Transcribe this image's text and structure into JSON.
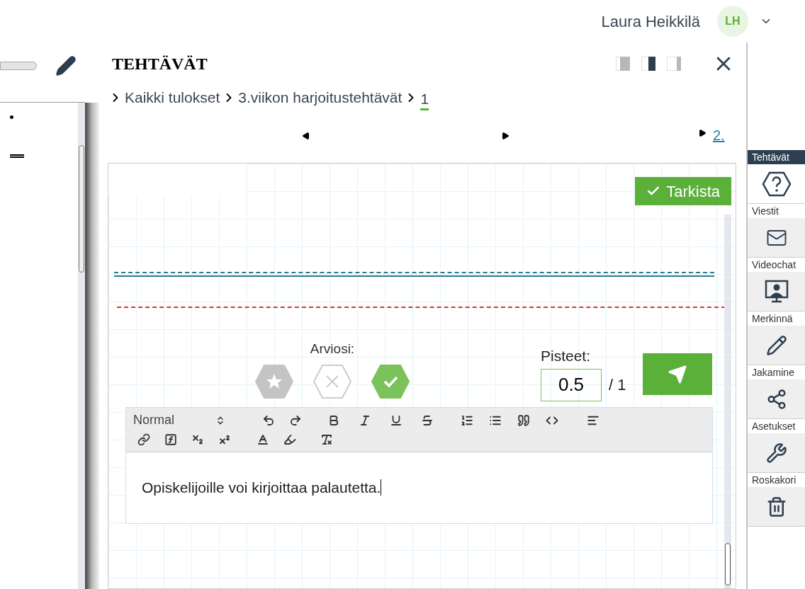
{
  "user": {
    "name": "Laura Heikkilä",
    "initials": "LH"
  },
  "panel": {
    "title": "TEHTÄVÄT",
    "view_modes": [
      {
        "kind": "left",
        "selected": false
      },
      {
        "kind": "half",
        "selected": true
      },
      {
        "kind": "right",
        "selected": false
      }
    ],
    "breadcrumbs": [
      {
        "label": "Kaikki tulokset",
        "current": false
      },
      {
        "label": "3.viikon harjoitustehtävät",
        "current": false
      },
      {
        "label": "1",
        "current": true
      }
    ],
    "next_link": "2.",
    "check_button": "Tarkista",
    "rating_label": "Arviosi:",
    "ratings": [
      {
        "kind": "star",
        "selected": false
      },
      {
        "kind": "cross",
        "selected": false
      },
      {
        "kind": "check",
        "selected": true
      }
    ],
    "points_label": "Pisteet:",
    "points_value": "0.5",
    "points_max": "/ 1",
    "editor": {
      "format": "Normal",
      "text": "Opiskelijoille voi kirjoittaa palautetta."
    }
  },
  "sidebar": [
    {
      "label": "Tehtävät",
      "kind": "tasks",
      "selected": true
    },
    {
      "label": "Viestit",
      "kind": "mail",
      "selected": false
    },
    {
      "label": "Videochat",
      "kind": "video",
      "selected": false
    },
    {
      "label": "Merkinnä",
      "kind": "notes",
      "selected": false
    },
    {
      "label": "Jakamine",
      "kind": "share",
      "selected": false
    },
    {
      "label": "Asetukset",
      "kind": "settings",
      "selected": false
    },
    {
      "label": "Roskakori",
      "kind": "trash",
      "selected": false
    }
  ]
}
